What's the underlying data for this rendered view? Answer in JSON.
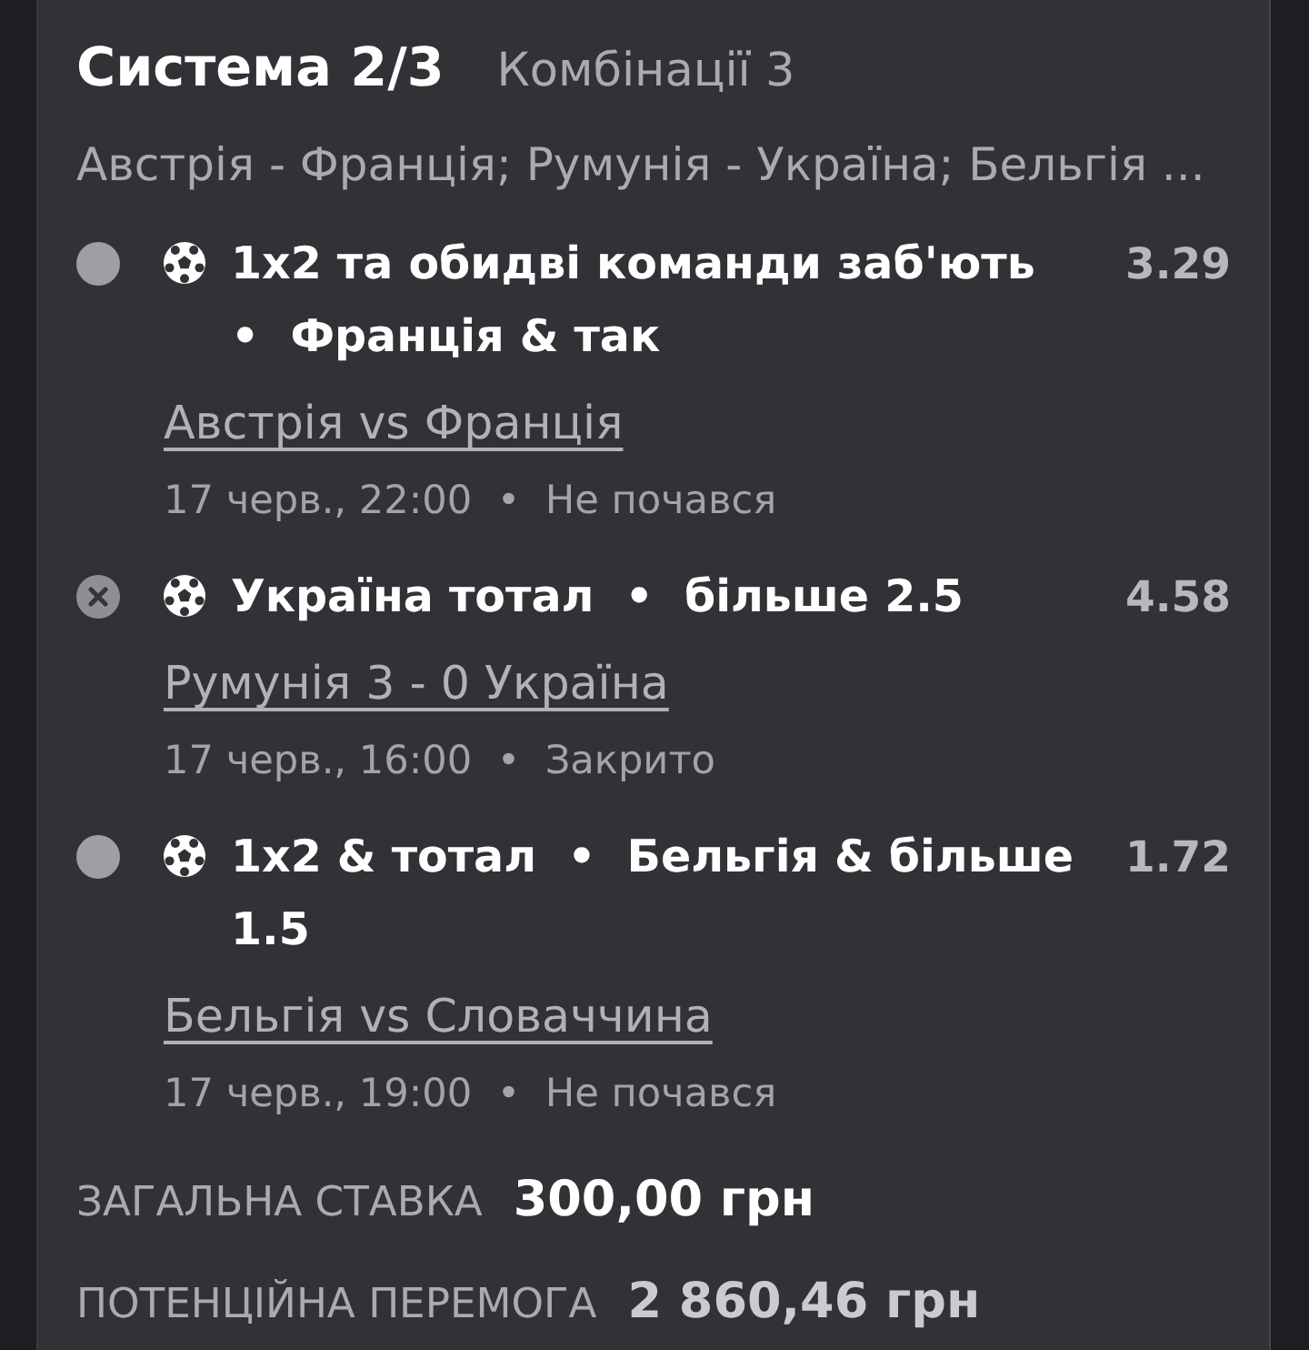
{
  "bet": {
    "title": "Система 2/3",
    "combinations": "Комбінації 3",
    "summary": "Австрія - Франція; Румунія - Україна; Бельгія ..."
  },
  "selections": [
    {
      "kind": "pending",
      "pick": "1x2 та обидві команди заб'ють  •  Франція & так",
      "odds": "3.29",
      "match": "Австрія vs Франція",
      "meta": "17 черв., 22:00  •  Не почався"
    },
    {
      "kind": "lost",
      "pick": "Україна тотал  •  більше 2.5",
      "odds": "4.58",
      "match": "Румунія 3 - 0 Україна",
      "meta": "17 черв., 16:00  •  Закрито"
    },
    {
      "kind": "pending",
      "pick": "1x2 & тотал  •  Бельгія & більше 1.5",
      "odds": "1.72",
      "match": "Бельгія vs Словаччина",
      "meta": "17 черв., 19:00  •  Не почався"
    }
  ],
  "totals": [
    {
      "kind": "stake",
      "label": "ЗАГАЛЬНА СТАВКА",
      "value": "300,00 грн"
    },
    {
      "kind": "payout",
      "label": "ПОТЕНЦІЙНА ПЕРЕМОГА",
      "value": "2 860,46 грн"
    }
  ]
}
